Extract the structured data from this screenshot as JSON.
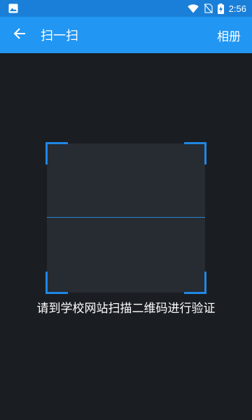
{
  "status_bar": {
    "time": "2:56",
    "icons": [
      "image-icon",
      "wifi-icon",
      "no-sim-icon",
      "battery-charging-icon"
    ]
  },
  "app_bar": {
    "title": "扫一扫",
    "album_label": "相册",
    "back_icon": "arrow-left-icon"
  },
  "scanner": {
    "hint": "请到学校网站扫描二维码进行验证"
  },
  "colors": {
    "app_bar": "#2196f3",
    "status_bar": "#1a7fd8",
    "background": "#1a1d21",
    "frame": "#272b32",
    "accent": "#1e88e5"
  }
}
